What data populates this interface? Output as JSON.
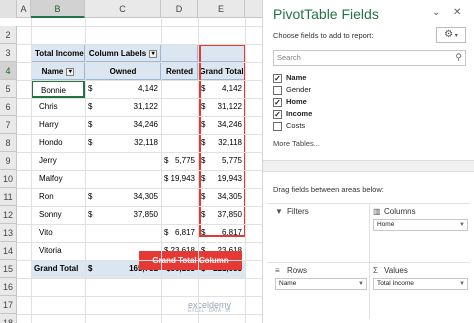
{
  "sheet": {
    "columns": [
      "A",
      "B",
      "C",
      "D",
      "E"
    ],
    "rows": [
      "2",
      "3",
      "4",
      "5",
      "6",
      "7",
      "8",
      "9",
      "10",
      "11",
      "12",
      "13",
      "14",
      "15",
      "16",
      "17",
      "18"
    ],
    "active_column": "B",
    "active_row": "4"
  },
  "pivot": {
    "title": "Total Income",
    "column_labels": "Column Labels",
    "headers": {
      "name": "Name",
      "owned": "Owned",
      "rented": "Rented",
      "grand_total": "Grand Total"
    },
    "currency": "$",
    "rows": [
      {
        "name": "Bonnie",
        "owned": "4,142",
        "rented": "",
        "total": "4,142"
      },
      {
        "name": "Chris",
        "owned": "31,122",
        "rented": "",
        "total": "31,122"
      },
      {
        "name": "Harry",
        "owned": "34,246",
        "rented": "",
        "total": "34,246"
      },
      {
        "name": "Hondo",
        "owned": "32,118",
        "rented": "",
        "total": "32,118"
      },
      {
        "name": "Jerry",
        "owned": "",
        "rented": "5,775",
        "total": "5,775"
      },
      {
        "name": "Malfoy",
        "owned": "",
        "rented": "19,943",
        "total": "19,943"
      },
      {
        "name": "Ron",
        "owned": "34,305",
        "rented": "",
        "total": "34,305"
      },
      {
        "name": "Sonny",
        "owned": "37,850",
        "rented": "",
        "total": "37,850"
      },
      {
        "name": "Vito",
        "owned": "",
        "rented": "6,817",
        "total": "6,817"
      },
      {
        "name": "Vitoria",
        "owned": "",
        "rented": "23,618",
        "total": "23,618"
      }
    ],
    "grand_total": {
      "label": "Grand Total",
      "owned": "165,781",
      "rented": "$56,153",
      "total": "221,933"
    },
    "callout": "Grand Total Column"
  },
  "pane": {
    "title": "PivotTable Fields",
    "choose_label": "Choose fields to add to report:",
    "search_placeholder": "Search",
    "fields": [
      {
        "label": "Name",
        "checked": true
      },
      {
        "label": "Gender",
        "checked": false
      },
      {
        "label": "Home",
        "checked": true
      },
      {
        "label": "Income",
        "checked": true
      },
      {
        "label": "Costs",
        "checked": false
      }
    ],
    "more_tables": "More Tables...",
    "drag_label": "Drag fields between areas below:",
    "areas": {
      "filters": "Filters",
      "columns": "Columns",
      "columns_item": "Home",
      "rows": "Rows",
      "rows_item": "Name",
      "values": "Values",
      "values_item": "Total Income"
    }
  },
  "watermark": {
    "brand": "exceldemy",
    "tagline": "EXCEL · DATA · BI"
  },
  "colors": {
    "excel_green": "#217346",
    "header_blue": "#dce6f1",
    "callout_red": "#e53935"
  }
}
